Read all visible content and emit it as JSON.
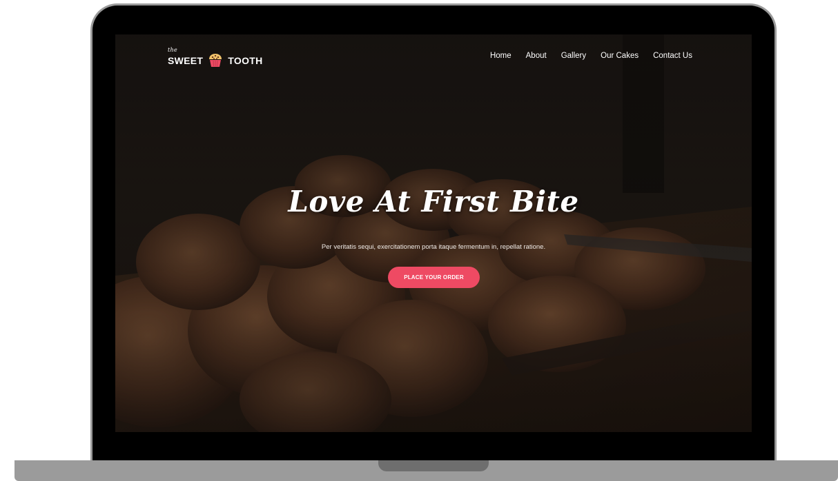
{
  "brand": {
    "the": "the",
    "name_left": "SWEET",
    "name_right": "TOOTH",
    "icon": "cupcake-icon"
  },
  "nav": {
    "items": [
      {
        "label": "Home"
      },
      {
        "label": "About"
      },
      {
        "label": "Gallery"
      },
      {
        "label": "Our Cakes"
      },
      {
        "label": "Contact Us"
      }
    ]
  },
  "hero": {
    "title": "Love At First Bite",
    "subtitle": "Per veritatis sequi, exercitationem porta itaque fermentum in, repellat ratione.",
    "cta_label": "PLACE YOUR ORDER"
  },
  "colors": {
    "accent": "#ee4a63",
    "text": "#ffffff",
    "bezel": "#000000",
    "base": "#9b9b9b"
  }
}
